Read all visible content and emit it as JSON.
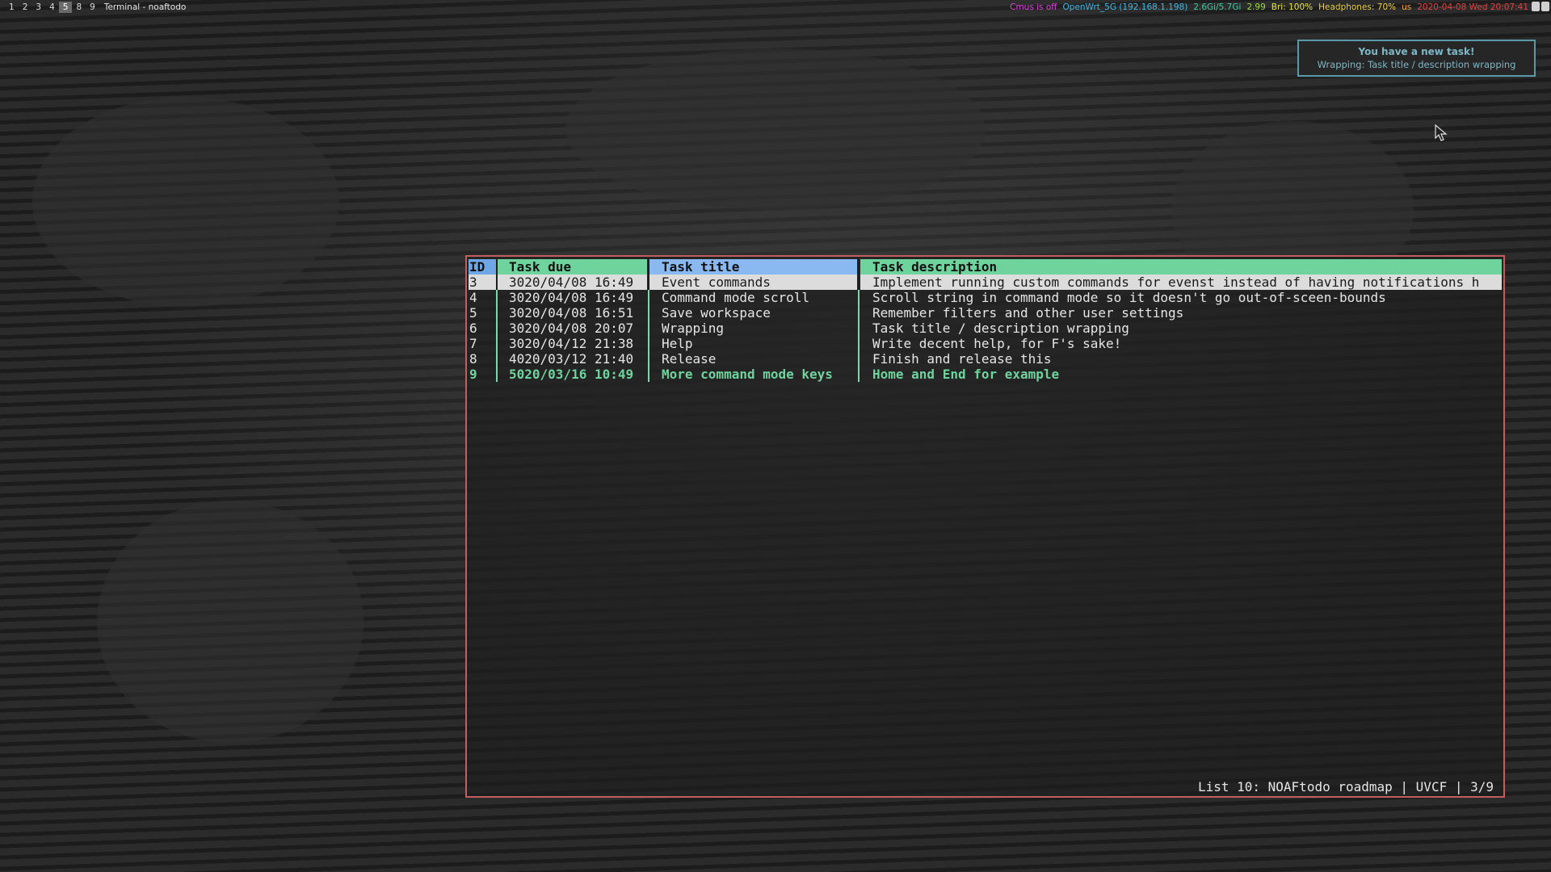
{
  "desktop": {
    "workspaces": [
      "1",
      "2",
      "3",
      "4",
      "5",
      "8",
      "9"
    ],
    "active_workspace": "5",
    "window_title": "Terminal - noaftodo"
  },
  "status_bar": {
    "cmus": {
      "text": "Cmus is off",
      "color": "#d943d9"
    },
    "network": {
      "text": "OpenWrt_5G (192.168.1.198)",
      "color": "#3fb7e6"
    },
    "memory": {
      "text": "2.6Gi/5.7Gi",
      "color": "#3fc9a0"
    },
    "load": {
      "text": "2.99",
      "color": "#9ad93f"
    },
    "brightness": {
      "text": "Bri: 100%",
      "color": "#e6e63f"
    },
    "volume": {
      "text": "Headphones: 70%",
      "color": "#f0d43f"
    },
    "layout": {
      "text": "us",
      "color": "#f0a33f"
    },
    "datetime": {
      "text": "2020-04-08 Wed 20:07:41",
      "color": "#e64040"
    }
  },
  "notification": {
    "title": "You have a new task!",
    "body": "Wrapping: Task title / description wrapping"
  },
  "task_table": {
    "headers": {
      "id": "ID",
      "due": "Task due",
      "title": "Task title",
      "description": "Task description"
    },
    "rows": [
      {
        "id": "3",
        "due": "3020/04/08 16:49",
        "title": "Event commands",
        "description": "Implement running custom commands for evenst instead of having notifications h",
        "state": "selected"
      },
      {
        "id": "4",
        "due": "3020/04/08 16:49",
        "title": "Command mode scroll",
        "description": "Scroll string in command mode so it doesn't go out-of-sceen-bounds",
        "state": "normal"
      },
      {
        "id": "5",
        "due": "3020/04/08 16:51",
        "title": "Save workspace",
        "description": "Remember filters and other user settings",
        "state": "normal"
      },
      {
        "id": "6",
        "due": "3020/04/08 20:07",
        "title": "Wrapping",
        "description": "Task title / description wrapping",
        "state": "normal"
      },
      {
        "id": "7",
        "due": "3020/04/12 21:38",
        "title": "Help",
        "description": "Write decent help, for F's sake!",
        "state": "normal"
      },
      {
        "id": "8",
        "due": "4020/03/12 21:40",
        "title": "Release",
        "description": "Finish and release this",
        "state": "normal"
      },
      {
        "id": "9",
        "due": "5020/03/16 10:49",
        "title": "More command mode keys",
        "description": "Home and End for example",
        "state": "highlight"
      }
    ]
  },
  "footer": {
    "text": "List 10: NOAFtodo roadmap | UVCF | 3/9"
  },
  "colors": {
    "window_border": "#c0605e",
    "header_green": "#6fd39e",
    "header_blue": "#8ab8f0",
    "selected_row": "#dcdcdc",
    "highlight_text": "#6fd39e",
    "notification_border": "#5a9aa8"
  }
}
